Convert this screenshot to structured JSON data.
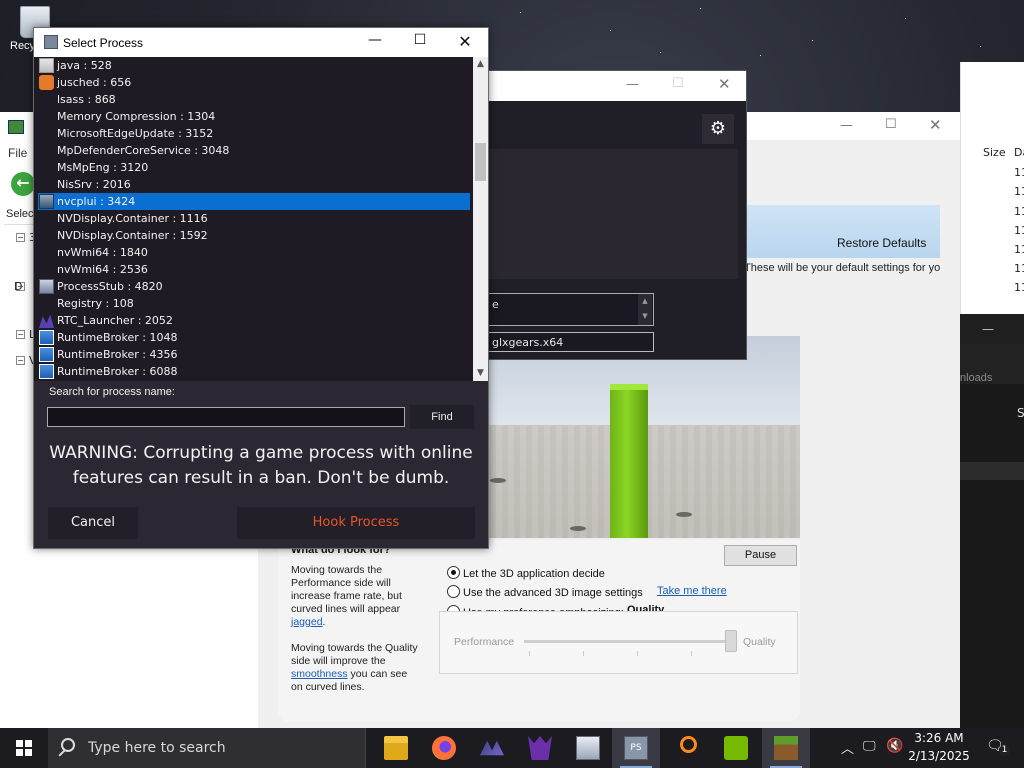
{
  "desktop": {
    "recycle_bin_label": "Recy"
  },
  "back_window": {
    "menu_file": "File",
    "select_label": "Select",
    "tree_labels": [
      "3",
      "D",
      "L",
      "V"
    ]
  },
  "right_list": {
    "col_size": "Size",
    "col_date": "Da",
    "cells": [
      "11",
      "11",
      "11",
      "11",
      "11",
      "11",
      "11"
    ]
  },
  "right_dark": {
    "partial_label": "nloads",
    "partial_col": "S"
  },
  "nvidia": {
    "restore_defaults": "Restore Defaults",
    "default_settings_text": "These will be your default settings for your",
    "what_heading": "What do I look for?",
    "help1_a": "Moving towards the Performance side will increase frame rate, but curved lines will appear ",
    "help1_link": "jagged",
    "help1_b": ".",
    "help2_a": "Moving towards the Quality side will improve the ",
    "help2_link": "smoothness",
    "help2_b": " you can see on curved lines.",
    "pause": "Pause",
    "radio_let_app": "Let the 3D application decide",
    "radio_advanced": "Use the advanced 3D image settings",
    "take_me_there": "Take me there",
    "radio_preference": "Use my preference emphasizing:",
    "preference_value": "Quality",
    "perf_label": "Performance",
    "qual_label": "Quality",
    "slider_level": 1.0
  },
  "mid_window": {
    "field1_value": "e",
    "field2_value": "glxgears.x64",
    "gear_icon": "gear-icon"
  },
  "dialog": {
    "title": "Select Process",
    "processes": [
      {
        "label": "java : 528",
        "icon": "java-icon"
      },
      {
        "label": "jusched : 656",
        "icon": "java-updater-icon"
      },
      {
        "label": "lsass : 868",
        "icon": ""
      },
      {
        "label": "Memory Compression : 1304",
        "icon": ""
      },
      {
        "label": "MicrosoftEdgeUpdate : 3152",
        "icon": ""
      },
      {
        "label": "MpDefenderCoreService : 3048",
        "icon": ""
      },
      {
        "label": "MsMpEng : 3120",
        "icon": ""
      },
      {
        "label": "NisSrv : 2016",
        "icon": ""
      },
      {
        "label": "nvcplui : 3424",
        "icon": "nvidia-panel-icon"
      },
      {
        "label": "NVDisplay.Container : 1116",
        "icon": ""
      },
      {
        "label": "NVDisplay.Container : 1592",
        "icon": ""
      },
      {
        "label": "nvWmi64 : 1840",
        "icon": ""
      },
      {
        "label": "nvWmi64 : 2536",
        "icon": ""
      },
      {
        "label": "ProcessStub : 4820",
        "icon": "process-stub-icon"
      },
      {
        "label": "Registry : 108",
        "icon": ""
      },
      {
        "label": "RTC_Launcher : 2052",
        "icon": "rtc-launcher-icon"
      },
      {
        "label": "RuntimeBroker : 1048",
        "icon": "runtime-broker-icon"
      },
      {
        "label": "RuntimeBroker : 4356",
        "icon": "runtime-broker-icon"
      },
      {
        "label": "RuntimeBroker : 6088",
        "icon": "runtime-broker-icon"
      }
    ],
    "selected_index": 8,
    "search_label": "Search for process name:",
    "search_value": "",
    "find": "Find",
    "warning": "WARNING: Corrupting a game process with online features can result in a ban.  Don't be dumb.",
    "cancel": "Cancel",
    "hook": "Hook Process"
  },
  "taskbar": {
    "search_placeholder": "Type here to search",
    "time": "3:26 AM",
    "date": "2/13/2025",
    "notification_count": "1"
  },
  "colors": {
    "accent": "#0a6fd1",
    "hook_text": "#e8552a",
    "nvidia_green": "#76b900"
  }
}
